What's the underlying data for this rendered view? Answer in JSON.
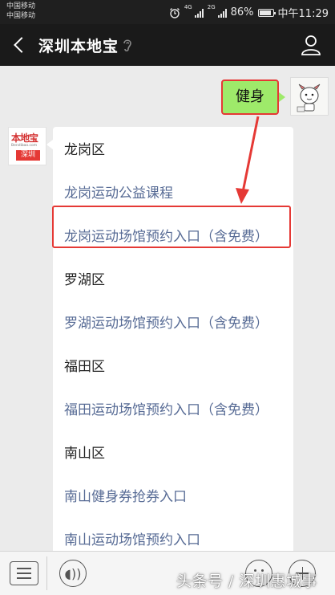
{
  "status_bar": {
    "carrier_1": "中国移动",
    "carrier_2": "中国移动",
    "net_1": "4G",
    "net_2": "2G",
    "battery": "86%",
    "time": "中午11:29"
  },
  "header": {
    "title": "深圳本地宝",
    "icons": [
      "back-icon",
      "ear-icon",
      "person-icon"
    ]
  },
  "chat": {
    "sent_message": "健身",
    "received_avatar": {
      "logo_name": "本地宝",
      "logo_url": "Bendibao.com",
      "logo_city": "深圳"
    },
    "reply": {
      "items": [
        {
          "text": "龙岗区",
          "type": "heading"
        },
        {
          "text": "龙岗运动公益课程",
          "type": "link"
        },
        {
          "text": "龙岗运动场馆预约入口（含免费）",
          "type": "link",
          "highlighted": true
        },
        {
          "text": "罗湖区",
          "type": "heading"
        },
        {
          "text": "罗湖运动场馆预约入口（含免费）",
          "type": "link"
        },
        {
          "text": "福田区",
          "type": "heading"
        },
        {
          "text": "福田运动场馆预约入口（含免费）",
          "type": "link"
        },
        {
          "text": "南山区",
          "type": "heading"
        },
        {
          "text": "南山健身券抢券入口",
          "type": "link"
        },
        {
          "text": "南山运动场馆预约入口",
          "type": "link"
        }
      ]
    }
  },
  "bottom_bar": {
    "icons": [
      "menu-icon",
      "voice-icon",
      "emoji-icon",
      "plus-icon"
    ],
    "watermark": "头条号 / 深圳惠城事"
  },
  "colors": {
    "bubble_green": "#9eea6a",
    "link_blue": "#576b95",
    "highlight_red": "#e53935",
    "header_dark": "#1a1a1a"
  }
}
